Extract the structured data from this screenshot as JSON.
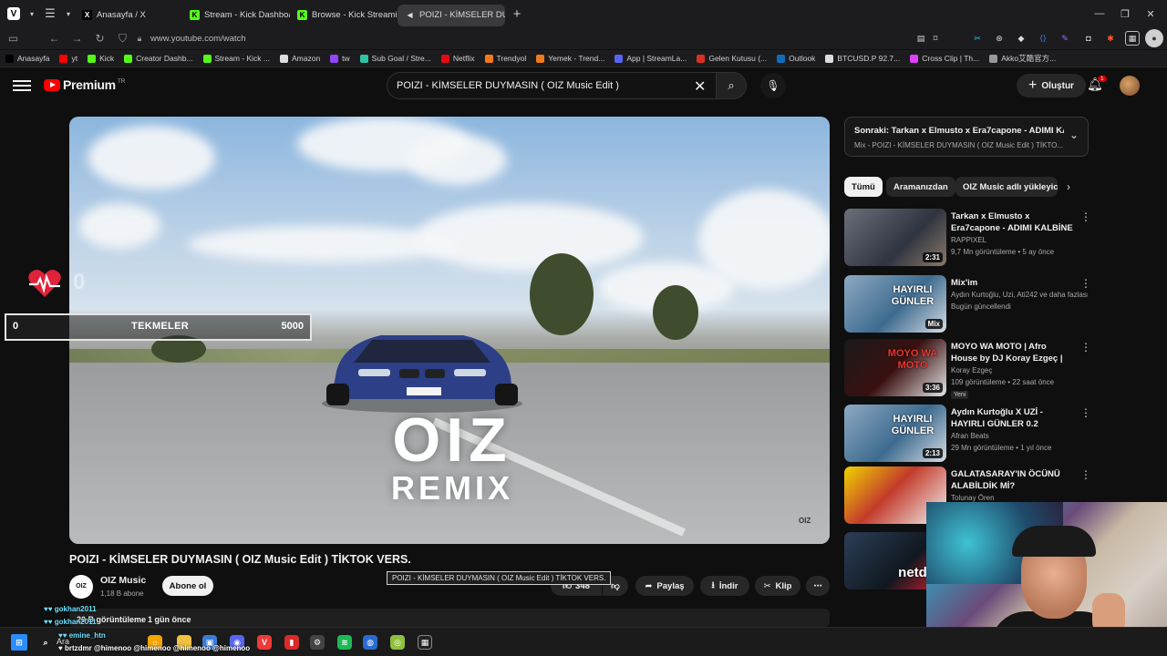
{
  "browser": {
    "tabs": [
      {
        "label": "Anasayfa / X",
        "favicon": "X",
        "color": "#000000"
      },
      {
        "label": "Stream - Kick Dashboard",
        "favicon": "K",
        "color": "#53fc18"
      },
      {
        "label": "Browse - Kick Streaming",
        "favicon": "K",
        "color": "#53fc18"
      },
      {
        "label": "POIZI - KİMSELER DUYMAS",
        "favicon": "▶",
        "color": "#ff0000"
      }
    ],
    "url": "www.youtube.com/watch",
    "bookmarks": [
      {
        "label": "Anasayfa",
        "color": "#000000"
      },
      {
        "label": "yt",
        "color": "#ff0000"
      },
      {
        "label": "Kick",
        "color": "#53fc18"
      },
      {
        "label": "Creator Dashb...",
        "color": "#53fc18"
      },
      {
        "label": "Stream - Kick ...",
        "color": "#53fc18"
      },
      {
        "label": "Amazon",
        "color": "#dddddd"
      },
      {
        "label": "tw",
        "color": "#9146ff"
      },
      {
        "label": "Sub Goal / Stre...",
        "color": "#2ec4a6"
      },
      {
        "label": "Netflix",
        "color": "#e50914"
      },
      {
        "label": "Trendyol",
        "color": "#f27a1a"
      },
      {
        "label": "Yemek - Trend...",
        "color": "#f27a1a"
      },
      {
        "label": "App | StreamLa...",
        "color": "#5865f2"
      },
      {
        "label": "Gelen Kutusu (...",
        "color": "#d93025"
      },
      {
        "label": "Outlook",
        "color": "#0f6cbd"
      },
      {
        "label": "BTCUSD.P 92.7...",
        "color": "#dddddd"
      },
      {
        "label": "Cross Clip | Th...",
        "color": "#e040fb"
      },
      {
        "label": "Akko艾酷官方...",
        "color": "#999999"
      }
    ]
  },
  "header": {
    "logo_word": "Premium",
    "logo_region": "TR",
    "search_value": "POIZI - KİMSELER DUYMASIN ( OIZ Music Edit )",
    "create_label": "Oluştur",
    "notifications": "1"
  },
  "overlay": {
    "heart_count": "0",
    "kick_current": "0",
    "kick_label": "TEKMELER",
    "kick_goal": "5000",
    "kick_progress": 0
  },
  "video": {
    "watermark_big": "OIZ",
    "watermark_small": "REMIX",
    "corner_mark": "OIZ",
    "title": "POIZI - KİMSELER DUYMASIN ( OIZ Music Edit ) TİKTOK VERS.",
    "channel": "OIZ Music",
    "channel_avatar_text": "OIZ",
    "subscribers": "1,18 B abone",
    "subscribe_label": "Abone ol",
    "likes": "348",
    "share_label": "Paylaş",
    "download_label": "İndir",
    "clip_label": "Klip",
    "tooltip": "POIZI - KİMSELER DUYMASIN ( OIZ Music Edit ) TİKTOK VERS.",
    "views": "20 B görüntüleme",
    "date": "1 gün önce"
  },
  "chat": [
    "gokhan2011",
    "gokhan2011",
    "emine_htn",
    "brtzdmr @himenoo @himenoo @himenoo @himenoo"
  ],
  "sidebar": {
    "next_title": "Sonraki: Tarkan x Elmusto x Era7capone - ADIMI KA...",
    "next_sub": "Mix - POIZI - KİMSELER DUYMASIN ( OIZ Music Edit ) TİKTO...",
    "chips": [
      "Tümü",
      "Aramanızdan",
      "OIZ Music adlı yükleyici"
    ],
    "recs": [
      {
        "title": "Tarkan x Elmusto x Era7capone - ADIMI KALBİNE YAZ 2.0 ...",
        "channel": "RAPPIXEL",
        "meta": "9,7 Mn görüntüleme • 5 ay önce",
        "duration": "2:31"
      },
      {
        "title": "Mix'im",
        "channel": "Aydın Kurtoğlu, Uzi, Ati242 ve daha fazlası",
        "meta": "Bugün güncellendi",
        "duration": "Mix",
        "thumb_text": "HAYIRLI GÜNLER"
      },
      {
        "title": "MOYO WA MOTO | Afro House by DJ Koray Ezgeç | #afrohous...",
        "channel": "Koray Ezgeç",
        "meta": "109 görüntüleme • 22 saat önce",
        "duration": "3:36",
        "badge": "Yeni",
        "thumb_text": "MOYO WA MOTO"
      },
      {
        "title": "Aydın Kurtoğlu X UZİ - HAYIRLI GÜNLER 0.2",
        "channel": "Afran Beats",
        "meta": "29 Mn görüntüleme • 1 yıl önce",
        "duration": "2:13",
        "thumb_text": "HAYIRLI GÜNLER"
      },
      {
        "title": "GALATASARAY'IN ÖCÜNÜ ALABİLDİK Mİ?",
        "channel": "Tolunay Ören",
        "meta": "",
        "duration": ""
      },
      {
        "title": "",
        "channel": "",
        "meta": "",
        "duration": "",
        "thumb_text": "netd"
      }
    ]
  },
  "taskbar": {
    "search_label": "Ara"
  }
}
